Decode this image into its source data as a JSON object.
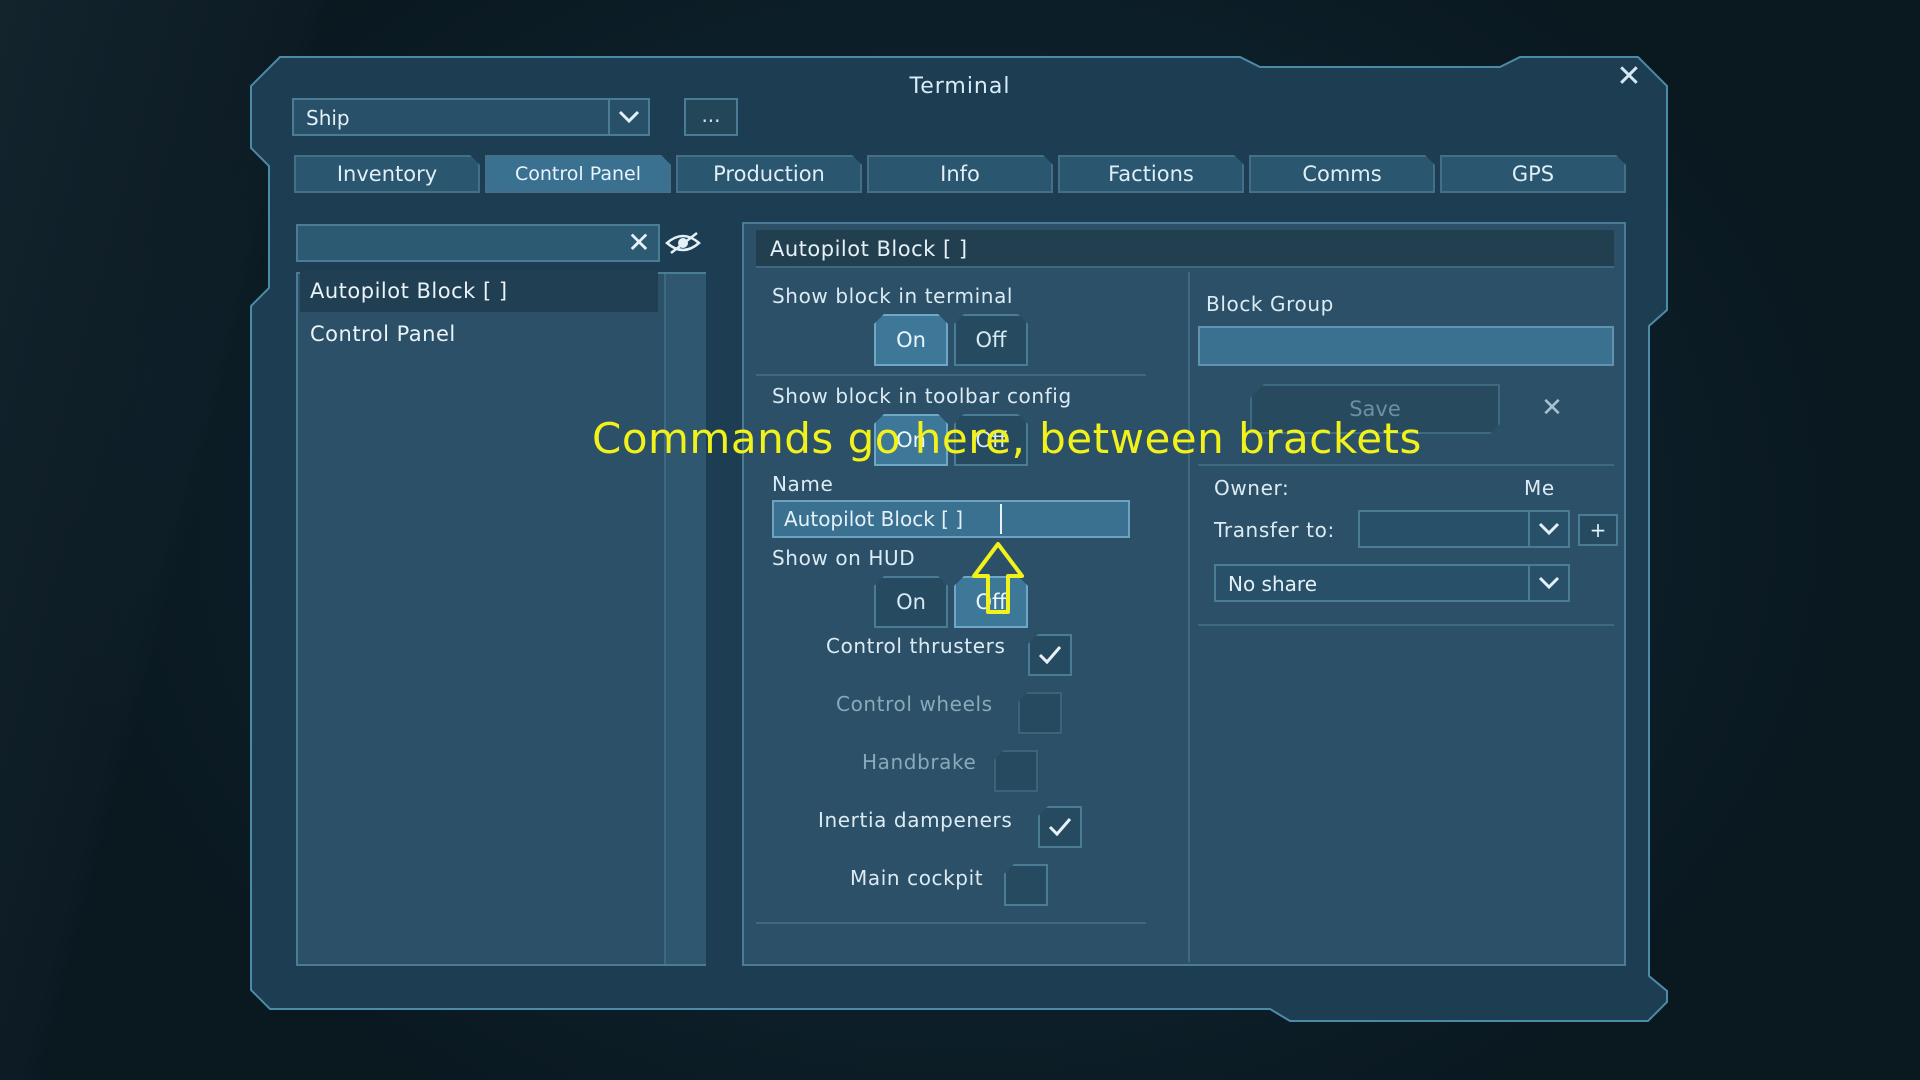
{
  "window": {
    "title": "Terminal"
  },
  "toolbar": {
    "ship_select_value": "Ship",
    "more_button_label": "..."
  },
  "tabs": [
    {
      "label": "Inventory"
    },
    {
      "label": "Control Panel",
      "active": true
    },
    {
      "label": "Production"
    },
    {
      "label": "Info"
    },
    {
      "label": "Factions"
    },
    {
      "label": "Comms"
    },
    {
      "label": "GPS"
    }
  ],
  "block_list": {
    "search_value": "",
    "items": [
      {
        "label": "Autopilot Block [        ]",
        "selected": true
      },
      {
        "label": "Control Panel"
      }
    ]
  },
  "details": {
    "header": "Autopilot Block [        ]",
    "show_in_terminal": {
      "label": "Show block in terminal",
      "on": "On",
      "off": "Off",
      "value": "On"
    },
    "show_in_toolbar": {
      "label": "Show block in toolbar config",
      "on": "On",
      "off": "Off",
      "value": "On"
    },
    "name": {
      "label": "Name",
      "value": "Autopilot Block [        ]"
    },
    "show_on_hud": {
      "label": "Show on HUD",
      "on": "On",
      "off": "Off",
      "value": "Off"
    },
    "options": [
      {
        "label": "Control thrusters",
        "checked": true,
        "enabled": true
      },
      {
        "label": "Control wheels",
        "checked": false,
        "enabled": false
      },
      {
        "label": "Handbrake",
        "checked": false,
        "enabled": false
      },
      {
        "label": "Inertia dampeners",
        "checked": true,
        "enabled": true
      },
      {
        "label": "Main cockpit",
        "checked": false,
        "enabled": true
      }
    ]
  },
  "group": {
    "label": "Block Group",
    "value": "",
    "save_label": "Save",
    "owner_label": "Owner:",
    "owner_value": "Me",
    "transfer_label": "Transfer to:",
    "transfer_value": "",
    "share_value": "No share",
    "plus_label": "+"
  },
  "annotation": {
    "text": "Commands go here, between brackets"
  },
  "colors": {
    "accent": "#3a7090",
    "annotation": "#f1f11b",
    "panel": "#2b5068"
  }
}
